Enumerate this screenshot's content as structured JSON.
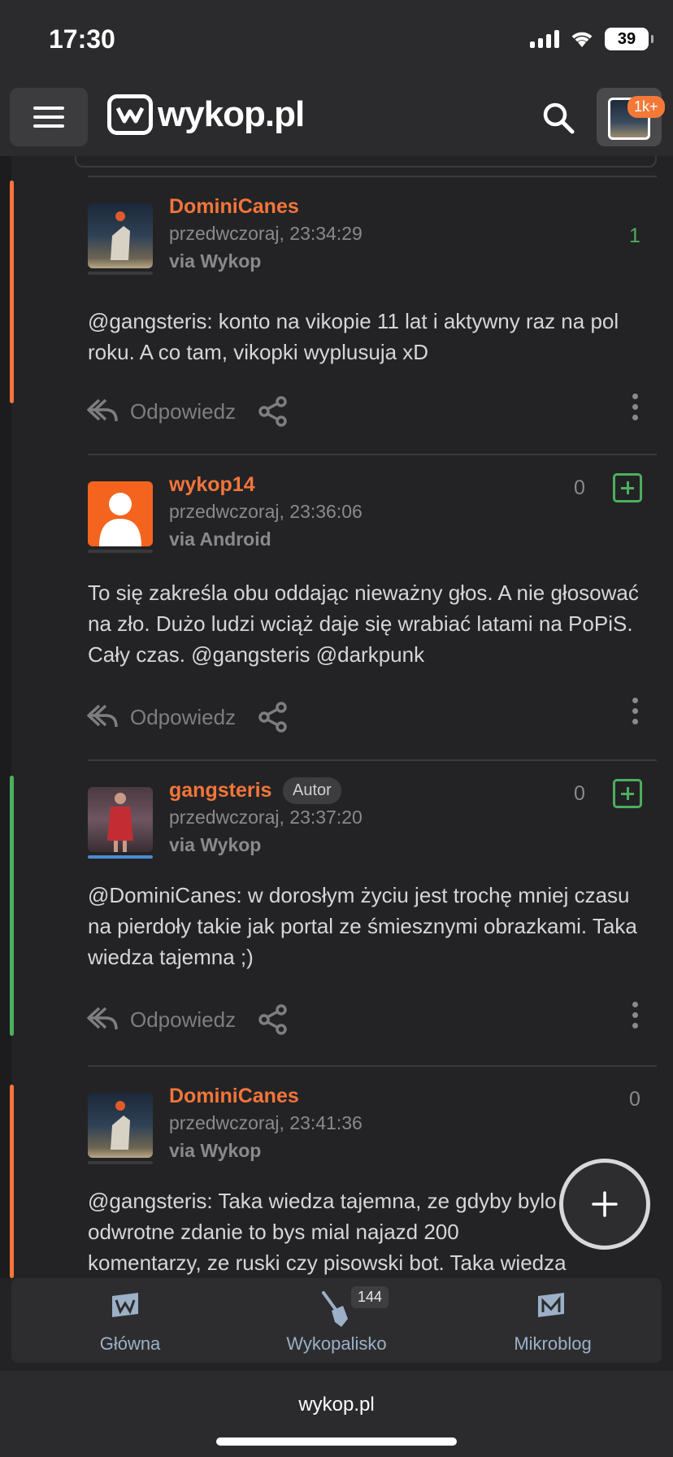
{
  "status": {
    "time": "17:30",
    "battery": "39"
  },
  "header": {
    "logo_text": "wykop.pl",
    "notif_badge": "1k+"
  },
  "comments": [
    {
      "author": "DominiCanes",
      "time": "przedwczoraj, 23:34:29",
      "via": "via Wykop",
      "score": "1",
      "text": "@gangsteris: konto na vikopie 11 lat i aktywny raz na pol roku. A co tam, vikopki wyplusuja xD",
      "reply": "Odpowiedz",
      "accent": "#f4753a"
    },
    {
      "author": "wykop14",
      "time": "przedwczoraj, 23:36:06",
      "via": "via Android",
      "score": "0",
      "text": "To się zakreśla obu oddając nieważny głos. A nie głosować na zło. Dużo ludzi wciąż daje się wrabiać latami na PoPiS. Cały czas. @gangsteris @darkpunk",
      "reply": "Odpowiedz"
    },
    {
      "author": "gangsteris",
      "badge": "Autor",
      "time": "przedwczoraj, 23:37:20",
      "via": "via Wykop",
      "score": "0",
      "text": "@DominiCanes: w dorosłym życiu jest trochę mniej czasu na pierdoły takie jak portal ze śmiesznymi obrazkami. Taka wiedza tajemna ;)",
      "reply": "Odpowiedz",
      "accent": "#4caf5c"
    },
    {
      "author": "DominiCanes",
      "time": "przedwczoraj, 23:41:36",
      "via": "via Wykop",
      "score": "0",
      "text": "@gangsteris: Taka wiedza tajemna, ze gdyby bylo odwrotne zdanie to bys mial najazd 200 komentarzy, ze ruski czy pisowski bot. Taka wiedza",
      "accent": "#f4753a"
    }
  ],
  "bottom_nav": [
    {
      "label": "Główna"
    },
    {
      "label": "Wykopalisko",
      "badge": "144"
    },
    {
      "label": "Mikroblog"
    }
  ],
  "browser": {
    "url": "wykop.pl"
  }
}
